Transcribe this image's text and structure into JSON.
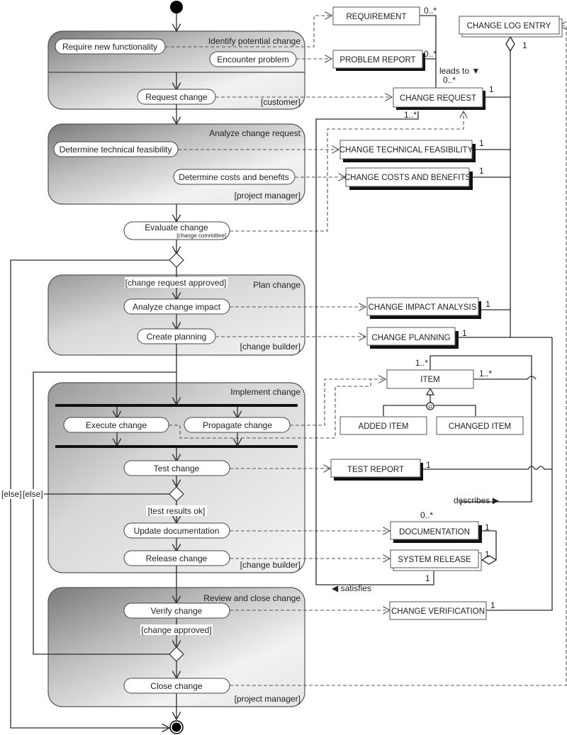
{
  "diagram": {
    "type": "UML activity diagram with deliverable class model"
  },
  "partitions": [
    {
      "id": "identify",
      "title": "Identify potential change",
      "role": "[customer]"
    },
    {
      "id": "analyze",
      "title": "Analyze change request",
      "role": "[project manager]"
    },
    {
      "id": "plan",
      "title": "Plan change",
      "role": "[change builder]"
    },
    {
      "id": "implement",
      "title": "Implement change",
      "role": "[change builder]"
    },
    {
      "id": "review",
      "title": "Review and close change",
      "role": "[project manager]"
    }
  ],
  "activities": {
    "require_new_functionality": "Require new functionality",
    "encounter_problem": "Encounter problem",
    "request_change": "Request change",
    "determine_technical_feasibility": "Determine technical feasibility",
    "determine_costs_and_benefits": "Determine costs and benefits",
    "evaluate_change": "Evaluate change",
    "evaluate_change_role": "[change committee]",
    "analyze_change_impact": "Analyze change impact",
    "create_planning": "Create planning",
    "execute_change": "Execute change",
    "propagate_change": "Propagate change",
    "test_change": "Test change",
    "update_documentation": "Update documentation",
    "release_change": "Release change",
    "verify_change": "Verify change",
    "close_change": "Close change"
  },
  "guards": {
    "change_request_approved": "[change request approved]",
    "test_results_ok": "[test results ok]",
    "change_approved": "[change approved]",
    "else_outer": "[else]",
    "else_inner": "[else]"
  },
  "classes": {
    "requirement": "REQUIREMENT",
    "problem_report": "PROBLEM REPORT",
    "change_request": "CHANGE REQUEST",
    "change_log_entry": "CHANGE LOG ENTRY",
    "change_technical_feasibility": "CHANGE TECHNICAL FEASIBILITY",
    "change_costs_and_benefits": "CHANGE COSTS AND BENEFITS",
    "change_impact_analysis": "CHANGE IMPACT ANALYSIS",
    "change_planning": "CHANGE PLANNING",
    "item": "ITEM",
    "added_item": "ADDED ITEM",
    "changed_item": "CHANGED ITEM",
    "test_report": "TEST REPORT",
    "documentation": "DOCUMENTATION",
    "system_release": "SYSTEM RELEASE",
    "change_verification": "CHANGE VERIFICATION"
  },
  "associations": {
    "leads_to": "leads to ▼",
    "describes": "describes ▶",
    "satisfies": "◀  satisfies"
  },
  "multiplicities": {
    "requirement": "0..*",
    "problem_report": "0..*",
    "change_request_top": "0..*",
    "change_request_right": "1",
    "change_request_bottom": "1..*",
    "change_log_entry": "1",
    "technical_feasibility": "1",
    "costs_and_benefits": "1",
    "impact_analysis": "1",
    "planning": "1",
    "item_top": "1..*",
    "item_right": "1..*",
    "test_report": "1",
    "documentation_top": "0..*",
    "documentation_right": "1",
    "system_release_right": "1",
    "system_release_bottom": "1",
    "change_verification": "1"
  },
  "generalization_marker": "O"
}
